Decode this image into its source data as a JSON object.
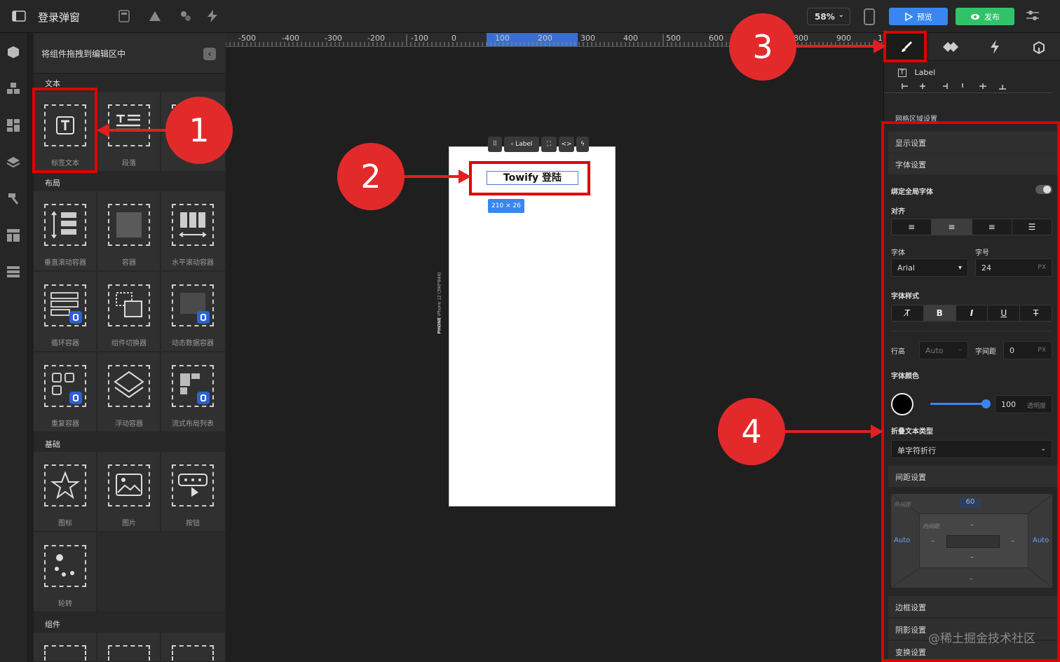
{
  "app": {
    "title": "登录弹窗"
  },
  "topbar": {
    "zoom": "58%",
    "preview_label": "预览",
    "publish_label": "发布"
  },
  "left_panel": {
    "hint": "将组件拖拽到编辑区中",
    "categories": {
      "text": "文本",
      "layout": "布局",
      "basic": "基础",
      "components": "组件"
    },
    "text_items": [
      "标签文本",
      "段落"
    ],
    "layout_items": [
      "垂直滚动容器",
      "容器",
      "水平滚动容器",
      "循环容器",
      "组件切换器",
      "动态数据容器",
      "重复容器",
      "浮动容器",
      "流式布局列表"
    ],
    "basic_items": [
      "图标",
      "图片",
      "按钮",
      "轮转"
    ]
  },
  "ruler": {
    "ticks": [
      "-500",
      "-400",
      "-300",
      "-200",
      "-100",
      "0",
      "100",
      "200",
      "300",
      "400",
      "500",
      "600",
      "800",
      "900",
      "1"
    ]
  },
  "canvas": {
    "phone_side_label": "iPhone 12 (390*844)",
    "phone_side_tag": "PHONE",
    "label_toolbar": "Label",
    "selected_text": "Towify 登陆",
    "selected_size": "210 × 26"
  },
  "right_panel": {
    "component": "Label",
    "sections": {
      "grid": "网格区域设置",
      "display": "显示设置",
      "font": "字体设置",
      "spacing": "间距设置",
      "border": "边框设置",
      "shadow": "阴影设置",
      "transform": "变换设置"
    },
    "bind_global_font": "绑定全局字体",
    "align_label": "对齐",
    "font_label": "字体",
    "font_value": "Arial",
    "size_label": "字号",
    "size_value": "24",
    "size_unit": "PX",
    "style_label": "字体样式",
    "line_height_label": "行高",
    "line_height_value": "Auto",
    "letter_spacing_label": "字间距",
    "letter_spacing_value": "0",
    "letter_spacing_unit": "PX",
    "color_label": "字体颜色",
    "opacity_value": "100",
    "opacity_label": "透明度",
    "opacity": 1.0,
    "wrap_label": "折叠文本类型",
    "wrap_value": "单字符折行",
    "spacing": {
      "outer_label": "外间距",
      "inner_label": "内间距",
      "top": "60",
      "left": "Auto",
      "right": "Auto",
      "dash": "–"
    }
  },
  "annotations": [
    "1",
    "2",
    "3",
    "4"
  ],
  "watermark": "@稀土掘金技术社区",
  "colors": {
    "accent": "#3a86f0",
    "publish": "#31c36a",
    "annotation": "#e32a2a"
  }
}
